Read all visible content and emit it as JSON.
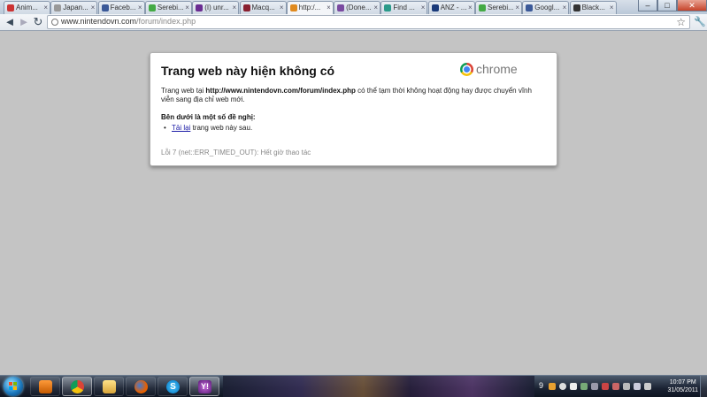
{
  "window": {
    "tabs": [
      {
        "label": "Anim...",
        "icon": "red"
      },
      {
        "label": "Japan...",
        "icon": "grey"
      },
      {
        "label": "Faceb...",
        "icon": "blue"
      },
      {
        "label": "Serebi...",
        "icon": "green"
      },
      {
        "label": "(I) unr...",
        "icon": "purple"
      },
      {
        "label": "Macq...",
        "icon": "maroon"
      },
      {
        "label": "http:/...",
        "icon": "orange",
        "active": true
      },
      {
        "label": "(Done...",
        "icon": "violet"
      },
      {
        "label": "Find ...",
        "icon": "teal"
      },
      {
        "label": "ANZ - ...",
        "icon": "navy"
      },
      {
        "label": "Serebi...",
        "icon": "green"
      },
      {
        "label": "Googl...",
        "icon": "blue"
      },
      {
        "label": "Black...",
        "icon": "dark"
      }
    ],
    "controls": {
      "minimize": "–",
      "maximize": "□",
      "close": "✕"
    }
  },
  "toolbar": {
    "back_icon": "◄",
    "forward_icon": "►",
    "reload_icon": "↻",
    "url_host": "www.nintendovn.com",
    "url_path": "/forum/index.php",
    "star_icon": "☆",
    "wrench_icon": "🔧"
  },
  "error": {
    "title": "Trang web này hiện không có",
    "brand": "chrome",
    "desc_prefix": "Trang web tại ",
    "desc_url": "http://www.nintendovn.com/forum/index.php",
    "desc_suffix": " có thể tạm thời không hoạt động hay được chuyển vĩnh viễn sang địa chỉ web mới.",
    "suggestion_title": "Bên dưới là một số đề nghị:",
    "suggestion_link": "Tải lại",
    "suggestion_rest": " trang web này sau.",
    "error_code": "Lỗi 7 (net::ERR_TIMED_OUT): Hết giờ thao tác"
  },
  "taskbar": {
    "apps": [
      "media-player",
      "chrome",
      "explorer",
      "firefox",
      "skype",
      "yahoo-messenger"
    ],
    "skype_glyph": "S",
    "yahoo_glyph": "Y!",
    "tray_count": "9",
    "time": "10:07 PM",
    "date": "31/05/2011"
  },
  "colors": {
    "page_bg": "#c4c4c4",
    "link": "#1a1aa6",
    "tab_close": "#c6432a"
  }
}
